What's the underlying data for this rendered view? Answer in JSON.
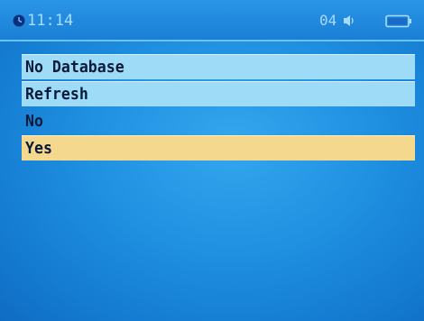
{
  "status_bar": {
    "time": "11:14",
    "volume_level": "04",
    "icons": {
      "clock": "clock-icon",
      "volume": "speaker-icon",
      "battery": "battery-icon"
    }
  },
  "menu": {
    "items": [
      {
        "label": "No Database",
        "kind": "header"
      },
      {
        "label": "Refresh",
        "kind": "header"
      },
      {
        "label": "No",
        "kind": "option"
      },
      {
        "label": "Yes",
        "kind": "option",
        "selected": true
      }
    ]
  },
  "colors": {
    "background": "#1f8fe0",
    "header_row": "#9edbf7",
    "selected_row": "#f4d88e",
    "status_text": "#a7dbff",
    "menu_text": "#0a1a3a"
  }
}
